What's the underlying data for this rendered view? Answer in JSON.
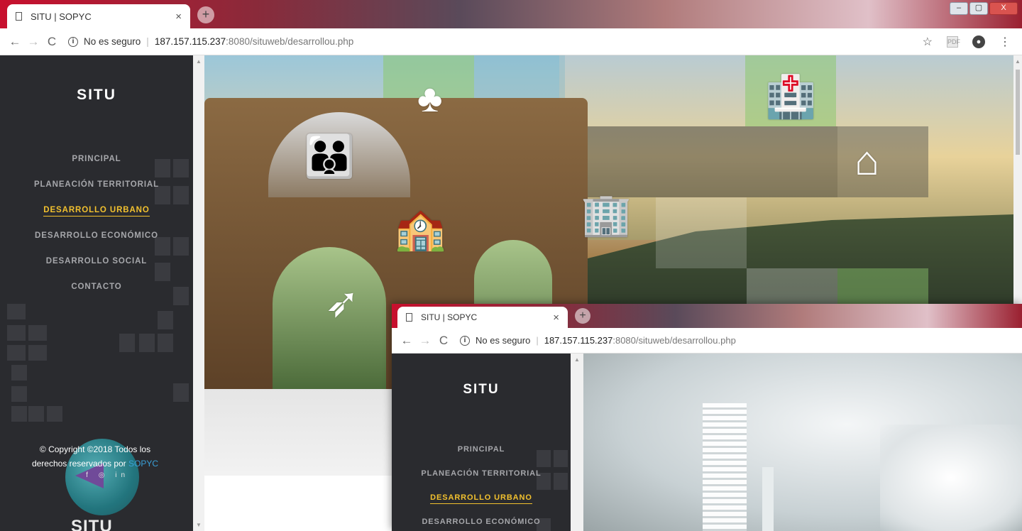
{
  "browser": {
    "tab_title": "SITU | SOPYC",
    "tab_close": "×",
    "new_tab": "+",
    "security_label": "No es seguro",
    "url_host": "187.157.115.237",
    "url_rest": ":8080/situweb/desarrollou.php",
    "window_controls": [
      "–",
      "▢",
      "X"
    ]
  },
  "sidebar": {
    "logo": "SITU",
    "items": [
      {
        "label": "PRINCIPAL",
        "active": false
      },
      {
        "label": "PLANEACIÓN TERRITORIAL",
        "active": false
      },
      {
        "label": "DESARROLLO URBANO",
        "active": true
      },
      {
        "label": "DESARROLLO ECONÓMICO",
        "active": false
      },
      {
        "label": "DESARROLLO SOCIAL",
        "active": false
      },
      {
        "label": "CONTACTO",
        "active": false
      }
    ],
    "copyright_prefix": "© Copyright ©2018 Todos los derechos reservados por",
    "copyright_brand": "SOPYC",
    "footer_logo": "SITU"
  },
  "overlay": {
    "tab_title": "SITU | SOPYC",
    "tab_close": "×",
    "new_tab": "+",
    "security_label": "No es seguro",
    "url_host": "187.157.115.237",
    "url_rest": ":8080/situweb/desarrollou.php",
    "sidebar": {
      "logo": "SITU",
      "items": [
        {
          "label": "PRINCIPAL"
        },
        {
          "label": "PLANEACIÓN TERRITORIAL"
        },
        {
          "label": "DESARROLLO URBANO"
        },
        {
          "label": "DESARROLLO ECONÓMICO"
        }
      ]
    }
  },
  "colors": {
    "sidebar_bg": "#2a2b2f",
    "nav_text": "#a6a7ab",
    "active": "#f2c12e",
    "brand_link": "#3aa0d8"
  },
  "icons": {
    "nav_back": "←",
    "nav_forward": "→",
    "reload": "C",
    "info": "i",
    "star": "☆",
    "pdf": "PDF",
    "account": "●",
    "menu": "⋮"
  }
}
